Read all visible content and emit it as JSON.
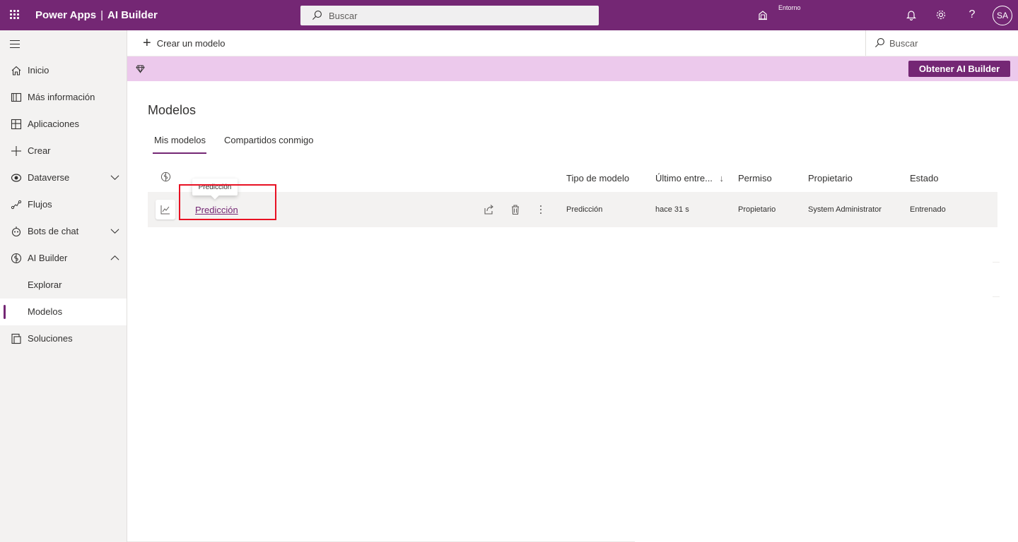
{
  "header": {
    "app_name": "Power Apps",
    "separator": "|",
    "section": "AI Builder",
    "search_placeholder": "Buscar",
    "environment_label": "Entorno",
    "help": "?",
    "avatar_initials": "SA"
  },
  "sidebar": {
    "items": [
      {
        "label": "Inicio",
        "icon": "home-icon"
      },
      {
        "label": "Más información",
        "icon": "book-icon"
      },
      {
        "label": "Aplicaciones",
        "icon": "apps-icon"
      },
      {
        "label": "Crear",
        "icon": "plus-icon"
      },
      {
        "label": "Dataverse",
        "icon": "dataverse-icon"
      },
      {
        "label": "Flujos",
        "icon": "flow-icon"
      },
      {
        "label": "Bots de chat",
        "icon": "bot-icon"
      },
      {
        "label": "AI Builder",
        "icon": "brain-icon"
      },
      {
        "label": "Explorar"
      },
      {
        "label": "Modelos"
      },
      {
        "label": "Soluciones",
        "icon": "solutions-icon"
      }
    ],
    "active": "Modelos"
  },
  "commandbar": {
    "new_model": "Crear un modelo",
    "search_placeholder": "Buscar"
  },
  "banner": {
    "get_button": "Obtener AI Builder"
  },
  "main": {
    "title": "Modelos",
    "tabs": [
      {
        "label": "Mis modelos",
        "selected": true
      },
      {
        "label": "Compartidos conmigo",
        "selected": false
      }
    ],
    "columns": {
      "type": "Tipo de modelo",
      "last_trained": "Último entre...",
      "sort_arrow": "↓",
      "permission": "Permiso",
      "owner": "Propietario",
      "status": "Estado"
    },
    "rows": [
      {
        "name": "Predicción",
        "type": "Predicción",
        "last_trained": "hace 31 s",
        "permission": "Propietario",
        "owner": "System Administrator",
        "status": "Entrenado"
      }
    ],
    "tooltip": "Predicción"
  },
  "colors": {
    "brand": "#742774",
    "banner": "#ecc9ec",
    "highlight": "#e81123"
  }
}
